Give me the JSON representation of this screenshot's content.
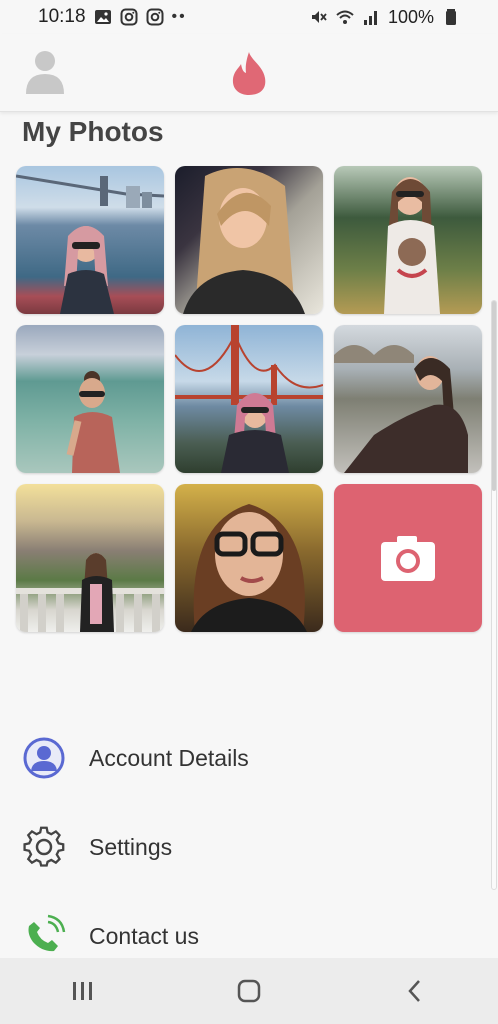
{
  "status_bar": {
    "time": "10:18",
    "battery_percent": "100%",
    "icons_left": [
      "image-icon",
      "instagram-icon",
      "instagram-icon",
      "more-dots-icon"
    ],
    "icons_right": [
      "mute-icon",
      "wifi-icon",
      "signal-icon",
      "battery-icon"
    ]
  },
  "header": {
    "profile_icon": "person-icon",
    "logo_icon": "flame-icon",
    "accent_color": "#e06875"
  },
  "photos": {
    "title": "My Photos",
    "items": [
      {
        "scene": "bay-bridge-sunglasses"
      },
      {
        "scene": "car-selfie"
      },
      {
        "scene": "park-tshirt"
      },
      {
        "scene": "beach-sunglasses"
      },
      {
        "scene": "golden-gate-bridge"
      },
      {
        "scene": "riverside-sitting"
      },
      {
        "scene": "city-terrace"
      },
      {
        "scene": "glasses-portrait"
      }
    ],
    "add_button_icon": "camera-icon",
    "add_button_color": "#dd6371"
  },
  "menu": {
    "items": [
      {
        "label": "Account Details",
        "icon": "account-icon"
      },
      {
        "label": "Settings",
        "icon": "gear-icon"
      },
      {
        "label": "Contact us",
        "icon": "phone-icon"
      }
    ]
  },
  "nav_bar": {
    "icons": [
      "recents-icon",
      "home-icon",
      "back-icon"
    ]
  }
}
